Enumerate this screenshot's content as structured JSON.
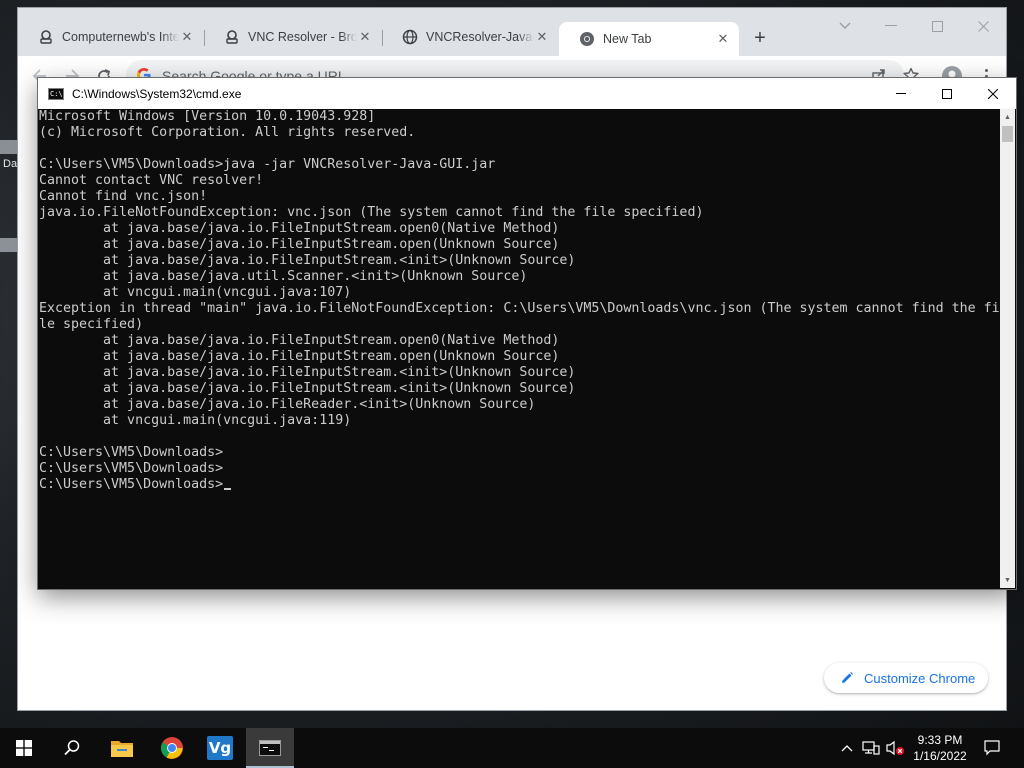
{
  "desktop": {
    "fragment_label": "Da"
  },
  "browser": {
    "tabs": [
      {
        "label": "Computernewb's Inte",
        "active": false
      },
      {
        "label": "VNC Resolver - Brows",
        "active": false
      },
      {
        "label": "VNCResolver-Java-GUI",
        "active": false
      },
      {
        "label": "New Tab",
        "active": true
      }
    ],
    "new_tab_symbol": "+",
    "omnibox_placeholder": "Search Google or type a URL",
    "customize_label": "Customize Chrome"
  },
  "cmd": {
    "title": "C:\\Windows\\System32\\cmd.exe",
    "icon_text": "C:\\",
    "lines": [
      "Microsoft Windows [Version 10.0.19043.928]",
      "(c) Microsoft Corporation. All rights reserved.",
      "",
      "C:\\Users\\VM5\\Downloads>java -jar VNCResolver-Java-GUI.jar",
      "Cannot contact VNC resolver!",
      "Cannot find vnc.json!",
      "java.io.FileNotFoundException: vnc.json (The system cannot find the file specified)",
      "        at java.base/java.io.FileInputStream.open0(Native Method)",
      "        at java.base/java.io.FileInputStream.open(Unknown Source)",
      "        at java.base/java.io.FileInputStream.<init>(Unknown Source)",
      "        at java.base/java.util.Scanner.<init>(Unknown Source)",
      "        at vncgui.main(vncgui.java:107)",
      "Exception in thread \"main\" java.io.FileNotFoundException: C:\\Users\\VM5\\Downloads\\vnc.json (The system cannot find the fi",
      "le specified)",
      "        at java.base/java.io.FileInputStream.open0(Native Method)",
      "        at java.base/java.io.FileInputStream.open(Unknown Source)",
      "        at java.base/java.io.FileInputStream.<init>(Unknown Source)",
      "        at java.base/java.io.FileInputStream.<init>(Unknown Source)",
      "        at java.base/java.io.FileReader.<init>(Unknown Source)",
      "        at vncgui.main(vncgui.java:119)",
      "",
      "C:\\Users\\VM5\\Downloads>",
      "C:\\Users\\VM5\\Downloads>",
      "C:\\Users\\VM5\\Downloads>"
    ],
    "colors": {
      "background": "#0c0c0c",
      "text": "#cccccc"
    }
  },
  "taskbar": {
    "apps": [
      {
        "name": "file-explorer",
        "active": false
      },
      {
        "name": "chrome",
        "active": false
      },
      {
        "name": "vm-app",
        "active": false
      },
      {
        "name": "command-prompt",
        "active": true
      }
    ],
    "vm_app_label": "Vg",
    "time": "9:33 PM",
    "date": "1/16/2022"
  }
}
